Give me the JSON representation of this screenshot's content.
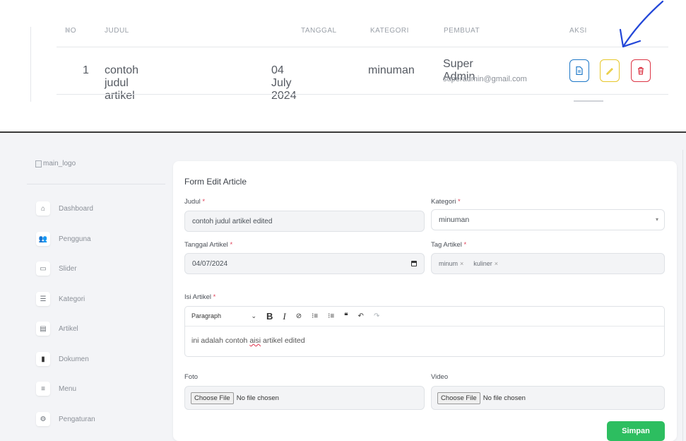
{
  "table": {
    "headers": {
      "no": "NO",
      "judul": "JUDUL",
      "tanggal": "TANGGAL",
      "kategori": "KATEGORI",
      "pembuat": "PEMBUAT",
      "aksi": "AKSI"
    },
    "rows": [
      {
        "no": "1",
        "judul": "contoh judul artikel",
        "tanggal": "04 July 2024",
        "kategori": "minuman",
        "pembuat_name": "Super Admin",
        "pembuat_email": "superadmin@gmail.com"
      }
    ]
  },
  "sidebar": {
    "logo_alt": "main_logo",
    "items": [
      {
        "label": "Dashboard",
        "icon": "home-icon"
      },
      {
        "label": "Pengguna",
        "icon": "users-icon"
      },
      {
        "label": "Slider",
        "icon": "image-icon"
      },
      {
        "label": "Kategori",
        "icon": "list-icon"
      },
      {
        "label": "Artikel",
        "icon": "newspaper-icon"
      },
      {
        "label": "Dokumen",
        "icon": "file-icon"
      },
      {
        "label": "Menu",
        "icon": "menu-icon"
      },
      {
        "label": "Pengaturan",
        "icon": "cogs-icon"
      }
    ]
  },
  "form": {
    "title": "Form Edit Article",
    "judul_label": "Judul",
    "judul_value": "contoh judul artikel edited",
    "kategori_label": "Kategori",
    "kategori_value": "minuman",
    "tanggal_label": "Tanggal Artikel",
    "tanggal_value": "04/07/2024",
    "tag_label": "Tag Artikel",
    "tags": [
      "minum",
      "kuliner"
    ],
    "tag_remove": "×",
    "isi_label": "Isi Artikel",
    "paragraph_label": "Paragraph",
    "content_before": "ini adalah contoh ",
    "content_misspelled": "aisi",
    "content_after": " artikel edited",
    "foto_label": "Foto",
    "video_label": "Video",
    "choose_file": "Choose File",
    "no_file": "No file chosen",
    "save_label": "Simpan",
    "required_mark": "*"
  },
  "colors": {
    "primary_blue": "#1e78c8",
    "edit_yellow": "#e7c72a",
    "delete_red": "#dc3545",
    "save_green": "#2dbe60",
    "required_red": "#e0435a"
  }
}
